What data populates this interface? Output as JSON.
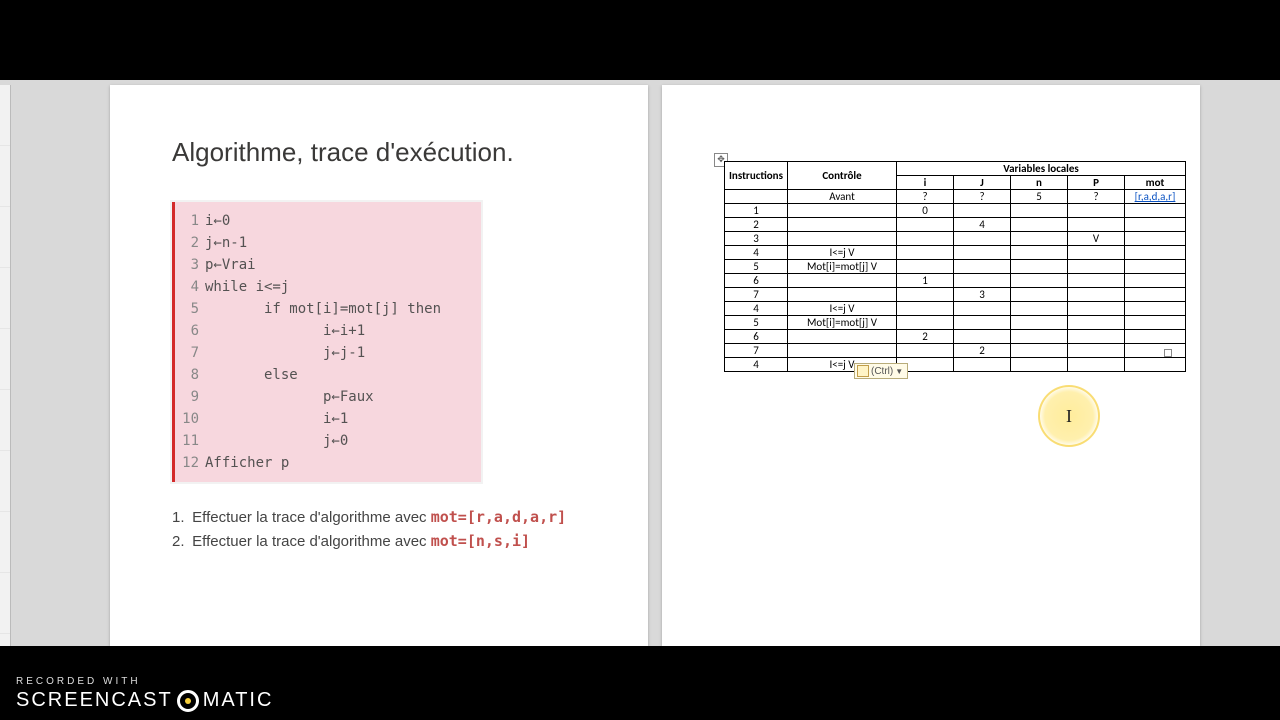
{
  "title": "Algorithme, trace d'exécution.",
  "code": {
    "1": "i←0",
    "2": "j←n-1",
    "3": "p←Vrai",
    "4": "while i<=j",
    "5": "       if mot[i]=mot[j] then",
    "6": "              i←i+1",
    "7": "              j←j-1",
    "8": "       else",
    "9": "              p←Faux",
    "10": "              i←1",
    "11": "              j←0",
    "12": "Afficher p"
  },
  "tasks": {
    "t1_num": "1.",
    "t1_text": "Effectuer la trace d'algorithme avec ",
    "t1_code": "mot=[r,a,d,a,r]",
    "t2_num": "2.",
    "t2_text": "Effectuer la trace d'algorithme avec ",
    "t2_code": "mot=[n,s,i]"
  },
  "table": {
    "h_instr": "Instructions",
    "h_ctrl": "Contrôle",
    "h_vars": "Variables locales",
    "h_i": "i",
    "h_j": "J",
    "h_n": "n",
    "h_p": "P",
    "h_mot": "mot",
    "r_avant": "Avant",
    "mot_init": "[r,a,d,a,r]",
    "rows": [
      {
        "instr": "",
        "ctrl": "Avant",
        "i": "?",
        "j": "?",
        "n": "5",
        "p": "?",
        "mot": "[r,a,d,a,r]"
      },
      {
        "instr": "1",
        "ctrl": "",
        "i": "0",
        "j": "",
        "n": "",
        "p": "",
        "mot": ""
      },
      {
        "instr": "2",
        "ctrl": "",
        "i": "",
        "j": "4",
        "n": "",
        "p": "",
        "mot": ""
      },
      {
        "instr": "3",
        "ctrl": "",
        "i": "",
        "j": "",
        "n": "",
        "p": "V",
        "mot": ""
      },
      {
        "instr": "4",
        "ctrl": "I<=j V",
        "i": "",
        "j": "",
        "n": "",
        "p": "",
        "mot": ""
      },
      {
        "instr": "5",
        "ctrl": "Mot[i]=mot[j] V",
        "i": "",
        "j": "",
        "n": "",
        "p": "",
        "mot": ""
      },
      {
        "instr": "6",
        "ctrl": "",
        "i": "1",
        "j": "",
        "n": "",
        "p": "",
        "mot": ""
      },
      {
        "instr": "7",
        "ctrl": "",
        "i": "",
        "j": "3",
        "n": "",
        "p": "",
        "mot": ""
      },
      {
        "instr": "4",
        "ctrl": "I<=j V",
        "i": "",
        "j": "",
        "n": "",
        "p": "",
        "mot": ""
      },
      {
        "instr": "5",
        "ctrl": "Mot[i]=mot[j] V",
        "i": "",
        "j": "",
        "n": "",
        "p": "",
        "mot": ""
      },
      {
        "instr": "6",
        "ctrl": "",
        "i": "2",
        "j": "",
        "n": "",
        "p": "",
        "mot": ""
      },
      {
        "instr": "7",
        "ctrl": "",
        "i": "",
        "j": "2",
        "n": "",
        "p": "",
        "mot": ""
      },
      {
        "instr": "4",
        "ctrl": "I<=j V",
        "i": "",
        "j": "",
        "n": "",
        "p": "",
        "mot": ""
      }
    ]
  },
  "paste_label": "(Ctrl) ",
  "handle_glyph": "✥",
  "cursor_glyph": "I",
  "watermark": {
    "line1": "RECORDED WITH",
    "brand_a": "SCREENCAST",
    "brand_b": "MATIC"
  }
}
